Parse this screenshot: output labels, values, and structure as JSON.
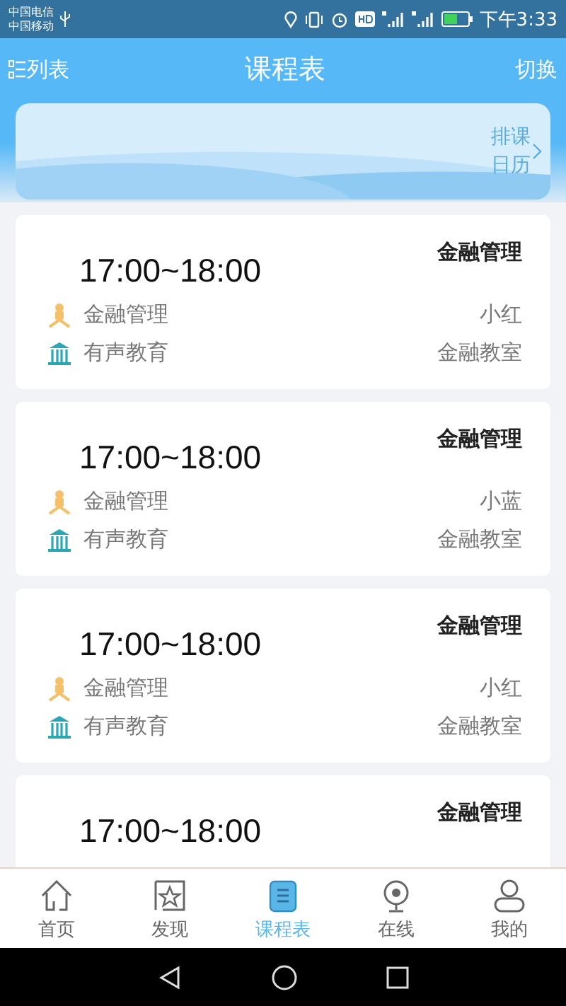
{
  "status_bar": {
    "carriers": [
      "中国电信",
      "中国移动"
    ],
    "time": "下午3:33"
  },
  "header": {
    "left": "列表",
    "title": "课程表",
    "right": "切换"
  },
  "banner": {
    "link": "排课日历"
  },
  "lessons": [
    {
      "time": "17:00~18:00",
      "title": "金融管理",
      "course": "金融管理",
      "teacher": "小红",
      "org": "有声教育",
      "room": "金融教室"
    },
    {
      "time": "17:00~18:00",
      "title": "金融管理",
      "course": "金融管理",
      "teacher": "小蓝",
      "org": "有声教育",
      "room": "金融教室"
    },
    {
      "time": "17:00~18:00",
      "title": "金融管理",
      "course": "金融管理",
      "teacher": "小红",
      "org": "有声教育",
      "room": "金融教室"
    },
    {
      "time": "17:00~18:00",
      "title": "金融管理"
    }
  ],
  "tabs": [
    {
      "kind": "home",
      "label": "首页",
      "selected": false
    },
    {
      "kind": "discover",
      "label": "发现",
      "selected": false
    },
    {
      "kind": "schedule",
      "label": "课程表",
      "selected": true
    },
    {
      "kind": "online",
      "label": "在线",
      "selected": false
    },
    {
      "kind": "mine",
      "label": "我的",
      "selected": false
    }
  ]
}
